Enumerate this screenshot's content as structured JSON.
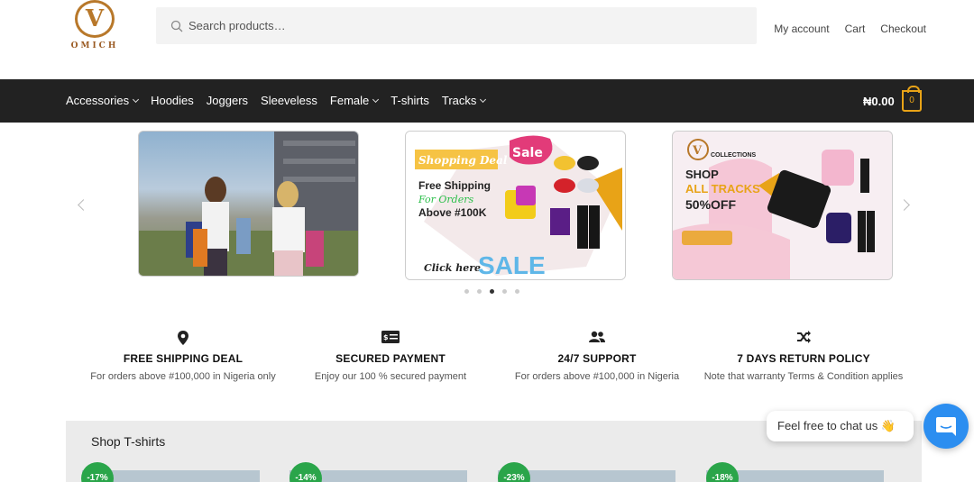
{
  "header": {
    "logo_letter": "V",
    "logo_text": "OMICH",
    "search_placeholder": "Search products…",
    "links": [
      "My account",
      "Cart",
      "Checkout"
    ]
  },
  "nav": {
    "items": [
      {
        "label": "Accessories",
        "dropdown": true
      },
      {
        "label": "Hoodies",
        "dropdown": false
      },
      {
        "label": "Joggers",
        "dropdown": false
      },
      {
        "label": "Sleeveless",
        "dropdown": false
      },
      {
        "label": "Female",
        "dropdown": true
      },
      {
        "label": "T-shirts",
        "dropdown": false
      },
      {
        "label": "Tracks",
        "dropdown": true
      }
    ],
    "cart_total": "₦0.00",
    "cart_count": "0"
  },
  "carousel": {
    "slide2": {
      "tag": "Shopping Deal",
      "sale_badge": "Sale",
      "line1": "Free Shipping",
      "line2": "For Orders",
      "line3": "Above #100K",
      "click": "Click here",
      "sale": "SALE"
    },
    "slide3": {
      "brand": "COLLECTIONS",
      "line1": "SHOP",
      "line2": "ALL TRACKS",
      "line3": "50%OFF"
    },
    "dot_count": 5,
    "active_dot": 2
  },
  "features": [
    {
      "icon": "location-pin-icon",
      "title": "FREE SHIPPING DEAL",
      "desc": "For orders above #100,000 in Nigeria only"
    },
    {
      "icon": "payment-card-icon",
      "title": "SECURED PAYMENT",
      "desc": "Enjoy our 100 % secured payment"
    },
    {
      "icon": "users-icon",
      "title": "24/7 SUPPORT",
      "desc": "For orders above #100,000 in Nigeria"
    },
    {
      "icon": "shuffle-icon",
      "title": "7 DAYS RETURN POLICY",
      "desc": "Note that warranty Terms & Condition applies"
    }
  ],
  "shop": {
    "title": "Shop T-shirts",
    "discounts": [
      "-17%",
      "-14%",
      "-23%",
      "-18%"
    ]
  },
  "chat": {
    "message": "Feel free to chat us 👋"
  },
  "colors": {
    "navbar": "#222222",
    "accent": "#e8a317",
    "discount": "#2aa54a",
    "chat_button": "#2c8ef0"
  }
}
